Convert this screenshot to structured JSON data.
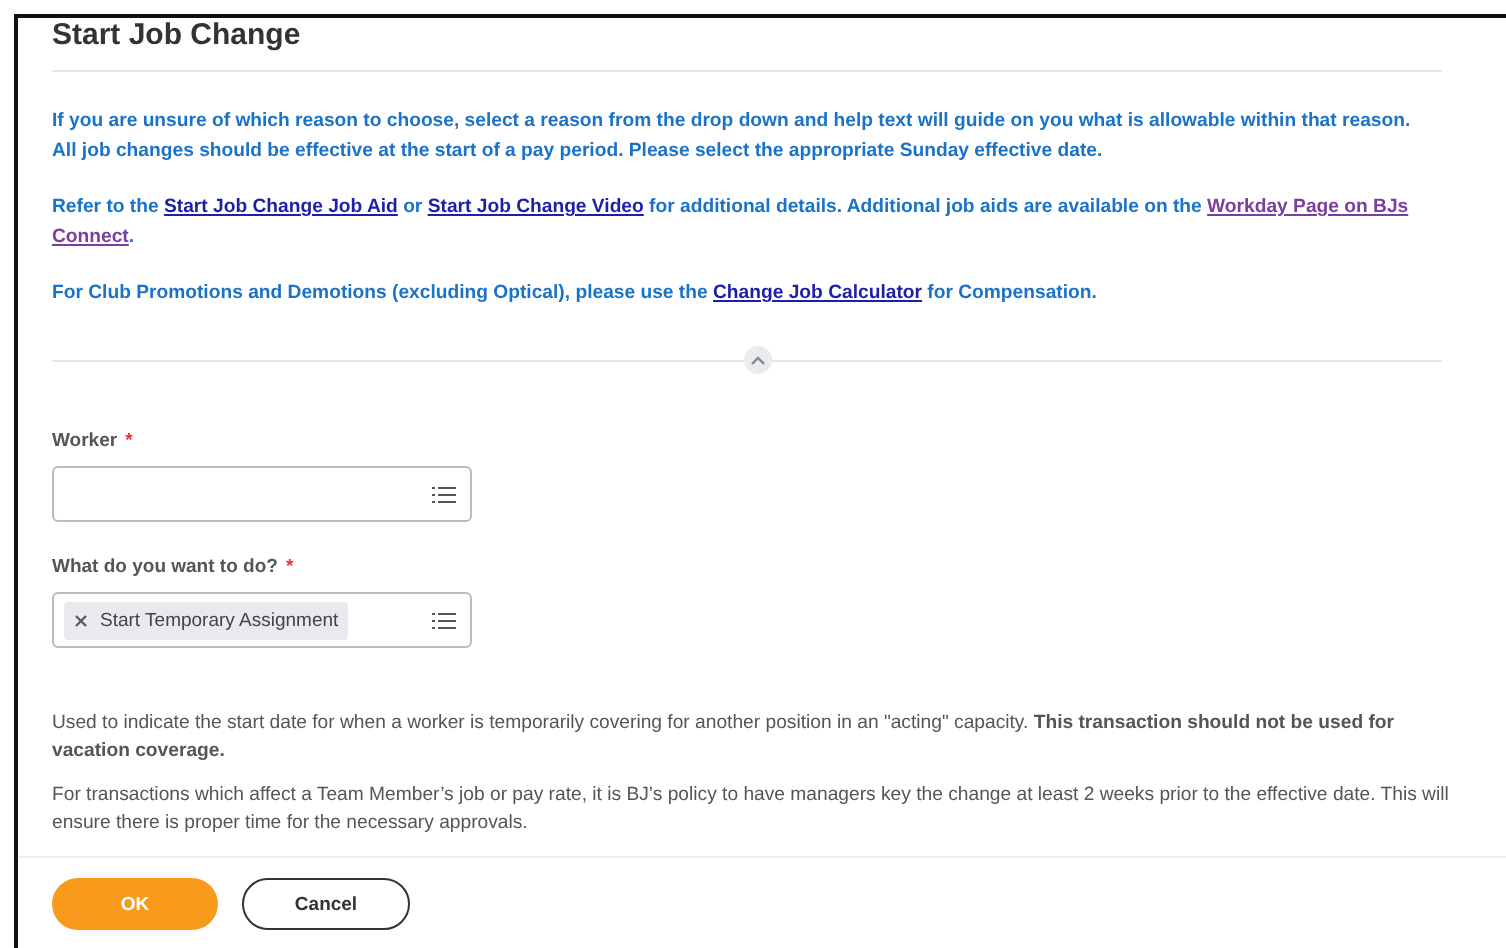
{
  "title": "Start Job Change",
  "instructions": [
    [
      {
        "kind": "text",
        "text": "If you are unsure of which reason to choose, select a reason from the drop down and help text will guide on you what is allowable within that reason."
      },
      {
        "kind": "break"
      },
      {
        "kind": "text",
        "text": "All job changes should be effective at the start of a pay period.  Please select the appropriate Sunday effective date."
      }
    ],
    [
      {
        "kind": "text",
        "text": "Refer to the "
      },
      {
        "kind": "link",
        "text": "Start Job Change Job Aid"
      },
      {
        "kind": "text",
        "text": " or "
      },
      {
        "kind": "link",
        "text": "Start Job Change Video"
      },
      {
        "kind": "text",
        "text": " for additional details.  Additional job aids are available on the "
      },
      {
        "kind": "visited_link",
        "text": "Workday Page on BJs"
      },
      {
        "kind": "break"
      },
      {
        "kind": "visited_link",
        "text": "Connect"
      },
      {
        "kind": "text",
        "text": "."
      }
    ],
    [
      {
        "kind": "text",
        "text": "For Club Promotions and Demotions (excluding Optical), please use the "
      },
      {
        "kind": "link",
        "text": "Change Job Calculator"
      },
      {
        "kind": "text",
        "text": " for Compensation."
      }
    ]
  ],
  "fields": [
    {
      "label": "Worker",
      "required_mark": "*"
    },
    {
      "label": "What do you want to do?",
      "required_mark": "*",
      "chips": [
        "Start Temporary Assignment"
      ]
    }
  ],
  "help": [
    "Used to indicate the start date for when a worker is temporarily covering for another position in an \"acting\" capacity. **This transaction should not be used for vacation coverage.**",
    "For transactions which affect a Team Member’s job or pay rate, it is BJ’s policy to have managers key the change at least 2 weeks prior to the effective date.  This will ensure there is proper time for the necessary approvals."
  ],
  "buttons": [
    {
      "label": "OK",
      "kind": "primary"
    },
    {
      "label": "Cancel",
      "kind": "secondary"
    }
  ]
}
